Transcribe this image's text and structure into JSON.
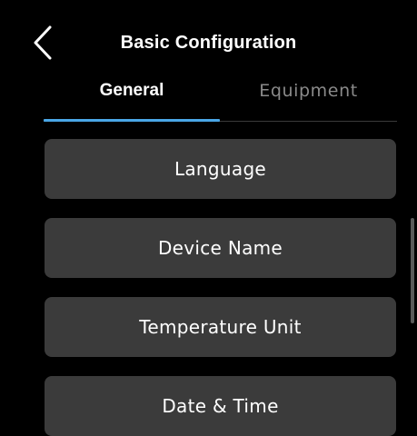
{
  "header": {
    "title": "Basic Configuration",
    "back_icon": "chevron-left-icon"
  },
  "tabs": [
    {
      "label": "General",
      "selected": true
    },
    {
      "label": "Equipment",
      "selected": false
    }
  ],
  "colors": {
    "background": "#000000",
    "tile": "#3b3b3b",
    "accent": "#4aa6e6",
    "inactive_tab": "#8a8a8a"
  },
  "menu": {
    "items": [
      {
        "label": "Language"
      },
      {
        "label": "Device Name"
      },
      {
        "label": "Temperature Unit"
      },
      {
        "label": "Date & Time"
      }
    ]
  }
}
